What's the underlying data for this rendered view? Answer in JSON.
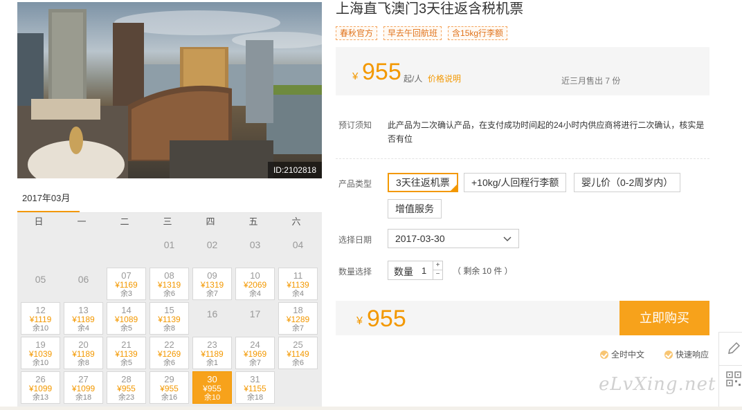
{
  "product": {
    "title": "上海直飞澳门3天往返含税机票",
    "image_id": "ID:2102818",
    "tags": [
      "春秋官方",
      "早去午回航班",
      "含15kg行李额"
    ]
  },
  "price_box": {
    "currency": "¥",
    "price": "955",
    "unit": "起/人",
    "price_note_link": "价格说明",
    "sold_text": "近三月售出 7 份"
  },
  "notice": {
    "label": "预订须知",
    "text": "此产品为二次确认产品，在支付成功时间起的24小时内供应商将进行二次确认，核实是否有位"
  },
  "product_type": {
    "label": "产品类型",
    "options": [
      "3天往返机票",
      "+10kg/人回程行李额",
      "婴儿价（0-2周岁内）",
      "增值服务"
    ],
    "selected": 0
  },
  "date": {
    "label": "选择日期",
    "value": "2017-03-30"
  },
  "quantity": {
    "label": "数量选择",
    "field_label": "数量",
    "value": "1",
    "plus": "+",
    "minus": "−",
    "remain_text": "（ 剩余 10 件 ）"
  },
  "total": {
    "currency": "¥",
    "amount": "955",
    "buy_button": "立即购买"
  },
  "services": [
    "全时中文",
    "快速响应"
  ],
  "watermark": "eLvXing.net",
  "calendar": {
    "month": "2017年03月",
    "weekdays": [
      "日",
      "一",
      "二",
      "三",
      "四",
      "五",
      "六"
    ],
    "first_weekday": 3,
    "days": [
      {
        "d": "01"
      },
      {
        "d": "02"
      },
      {
        "d": "03"
      },
      {
        "d": "04"
      },
      {
        "d": "05"
      },
      {
        "d": "06"
      },
      {
        "d": "07",
        "p": "¥1169",
        "r": "余3"
      },
      {
        "d": "08",
        "p": "¥1319",
        "r": "余6"
      },
      {
        "d": "09",
        "p": "¥1319",
        "r": "余7"
      },
      {
        "d": "10",
        "p": "¥2069",
        "r": "余4"
      },
      {
        "d": "11",
        "p": "¥1139",
        "r": "余4"
      },
      {
        "d": "12",
        "p": "¥1119",
        "r": "余10"
      },
      {
        "d": "13",
        "p": "¥1189",
        "r": "余4"
      },
      {
        "d": "14",
        "p": "¥1089",
        "r": "余5"
      },
      {
        "d": "15",
        "p": "¥1139",
        "r": "余8"
      },
      {
        "d": "16"
      },
      {
        "d": "17"
      },
      {
        "d": "18",
        "p": "¥1289",
        "r": "余7"
      },
      {
        "d": "19",
        "p": "¥1039",
        "r": "余10"
      },
      {
        "d": "20",
        "p": "¥1189",
        "r": "余8"
      },
      {
        "d": "21",
        "p": "¥1139",
        "r": "余5"
      },
      {
        "d": "22",
        "p": "¥1269",
        "r": "余6"
      },
      {
        "d": "23",
        "p": "¥1189",
        "r": "余1"
      },
      {
        "d": "24",
        "p": "¥1969",
        "r": "余7"
      },
      {
        "d": "25",
        "p": "¥1149",
        "r": "余6"
      },
      {
        "d": "26",
        "p": "¥1099",
        "r": "余13"
      },
      {
        "d": "27",
        "p": "¥1099",
        "r": "余18"
      },
      {
        "d": "28",
        "p": "¥955",
        "r": "余23"
      },
      {
        "d": "29",
        "p": "¥955",
        "r": "余16"
      },
      {
        "d": "30",
        "p": "¥955",
        "r": "余10",
        "selected": true
      },
      {
        "d": "31",
        "p": "¥1155",
        "r": "余18"
      }
    ]
  },
  "colors": {
    "accent": "#f39800",
    "buy_button": "#f7a21b",
    "panel_bg": "#f5f5f5"
  },
  "icons": {
    "dropdown": "chevron-down-icon",
    "service_check": "check-circle-icon",
    "side_tool_1": "pencil-icon",
    "side_tool_2": "qr-code-icon"
  }
}
